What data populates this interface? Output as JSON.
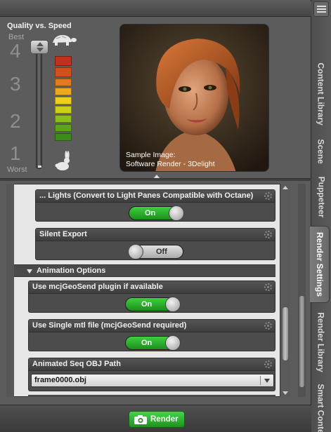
{
  "quality": {
    "title": "Quality vs. Speed",
    "best": "Best",
    "worst": "Worst",
    "scale": [
      "4",
      "3",
      "2",
      "1"
    ],
    "meter_colors": [
      "#c0301a",
      "#d3501d",
      "#e27a1c",
      "#eeaa1b",
      "#f0d017",
      "#cdd113",
      "#8cbf18",
      "#5aa51a",
      "#3c8c1c"
    ],
    "icons": {
      "top": "turtle-icon",
      "bottom": "rabbit-icon"
    }
  },
  "sample": {
    "caption_line1": "Sample Image:",
    "caption_line2": "Software Render - 3Delight"
  },
  "options": {
    "lights": {
      "label": "... Lights (Convert to Light Panes Compatible with Octane)",
      "state": "On"
    },
    "silent_export": {
      "label": "Silent Export",
      "state": "Off"
    },
    "animation_section": "Animation Options",
    "mcjgeosend": {
      "label": "Use mcjGeoSend plugin if available",
      "state": "On"
    },
    "single_mtl": {
      "label": "Use Single mtl file (mcjGeoSend required)",
      "state": "On"
    },
    "seq_path": {
      "label": "Animated Seq OBJ Path",
      "value": "frame0000.obj"
    }
  },
  "tabs": [
    "Content Library",
    "Scene",
    "Puppeteer",
    "Render Settings",
    "Render Library",
    "Smart Conte"
  ],
  "active_tab": "Render Settings",
  "render_button": "Render",
  "colors": {
    "toggle_on": "#2db52d",
    "panel": "#5c5c5c",
    "accent_green": "#1e931e"
  }
}
